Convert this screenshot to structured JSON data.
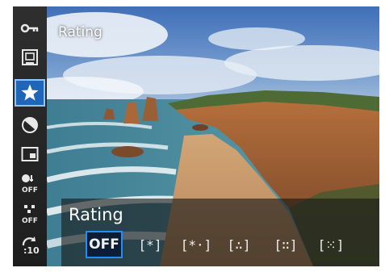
{
  "screen": {
    "title": "Rating",
    "menu_icons": [
      {
        "name": "protect-key-icon",
        "active": false
      },
      {
        "name": "rotate-image-icon",
        "active": false
      },
      {
        "name": "rating-star-icon",
        "active": true
      },
      {
        "name": "creative-filter-icon",
        "active": false
      },
      {
        "name": "resize-icon",
        "active": false
      },
      {
        "name": "highlight-alert-off-icon",
        "active": false
      },
      {
        "name": "af-point-display-off-icon",
        "active": false
      },
      {
        "name": "image-jump-10-icon",
        "active": false
      }
    ]
  },
  "rating_panel": {
    "title": "Rating",
    "options": [
      "OFF",
      "[*]",
      "[*·]",
      "[∴]",
      "[∷]",
      "[⁙]"
    ],
    "selected_index": 0
  },
  "colors": {
    "accent": "#1f8cff",
    "menu_active": "#1f66b8"
  }
}
